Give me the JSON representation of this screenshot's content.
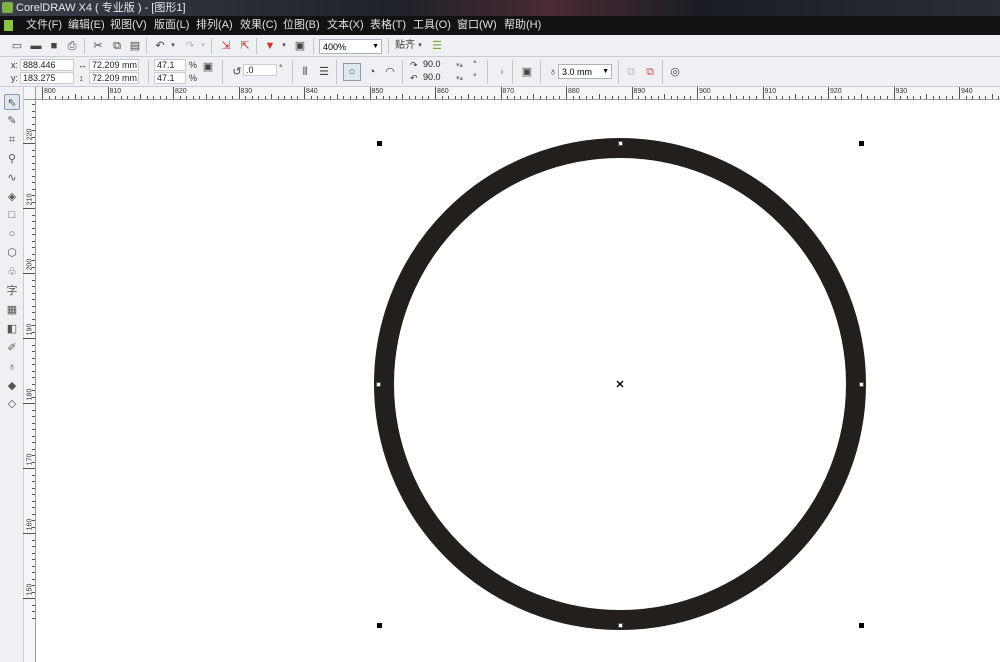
{
  "window": {
    "title": "CorelDRAW X4 ( 专业版 ) - [图形1]"
  },
  "menu": [
    "文件(F)",
    "编辑(E)",
    "视图(V)",
    "版面(L)",
    "排列(A)",
    "效果(C)",
    "位图(B)",
    "文本(X)",
    "表格(T)",
    "工具(O)",
    "窗口(W)",
    "帮助(H)"
  ],
  "toolbar": {
    "zoom": "400%",
    "snap": "贴齐"
  },
  "property_bar": {
    "x": "888.446 mm",
    "y": "183.275 mm",
    "width": "72.209 mm",
    "height": "72.209 mm",
    "scale_x": "47.1",
    "scale_y": "47.1",
    "percent": "%",
    "rotation": ".0",
    "degree": "°",
    "start_angle": "90.0",
    "end_angle": "90.0",
    "outline_width": "3.0 mm"
  },
  "rulers": {
    "horizontal": [
      "800",
      "810",
      "820",
      "830",
      "840",
      "850",
      "860",
      "870",
      "880",
      "890",
      "900",
      "910",
      "920",
      "930",
      "940"
    ],
    "vertical": [
      "220",
      "210",
      "200",
      "190",
      "180",
      "170",
      "160",
      "150"
    ]
  },
  "colors": {
    "circle_outline": "#231f1c",
    "menubar": "#101214",
    "toolbar": "#eef0f3"
  },
  "shape": {
    "type": "ellipse",
    "outline": "3.0 mm"
  }
}
